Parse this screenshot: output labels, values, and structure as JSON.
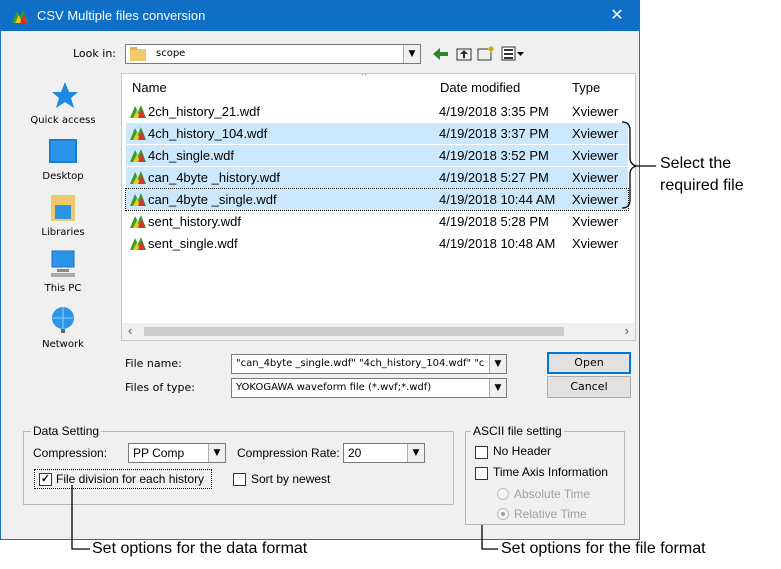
{
  "window": {
    "title": "CSV Multiple files conversion",
    "close_glyph": "✕"
  },
  "look_in": {
    "label": "Look in:",
    "value": "scope"
  },
  "places": [
    {
      "label": "Quick access",
      "icon": "star-icon"
    },
    {
      "label": "Desktop",
      "icon": "desktop-icon"
    },
    {
      "label": "Libraries",
      "icon": "libraries-icon"
    },
    {
      "label": "This PC",
      "icon": "computer-icon"
    },
    {
      "label": "Network",
      "icon": "network-icon"
    }
  ],
  "columns": {
    "name": "Name",
    "date": "Date modified",
    "type": "Type"
  },
  "files": [
    {
      "name": "2ch_history_21.wdf",
      "date": "4/19/2018 3:35 PM",
      "type": "Xviewer",
      "selected": false
    },
    {
      "name": "4ch_history_104.wdf",
      "date": "4/19/2018 3:37 PM",
      "type": "Xviewer",
      "selected": true
    },
    {
      "name": "4ch_single.wdf",
      "date": "4/19/2018 3:52 PM",
      "type": "Xviewer",
      "selected": true
    },
    {
      "name": "can_4byte _history.wdf",
      "date": "4/19/2018 5:27 PM",
      "type": "Xviewer",
      "selected": true
    },
    {
      "name": "can_4byte _single.wdf",
      "date": "4/19/2018 10:44 AM",
      "type": "Xviewer",
      "selected": true
    },
    {
      "name": "sent_history.wdf",
      "date": "4/19/2018 5:28 PM",
      "type": "Xviewer",
      "selected": false
    },
    {
      "name": "sent_single.wdf",
      "date": "4/19/2018 10:48 AM",
      "type": "Xviewer",
      "selected": false
    }
  ],
  "file_name": {
    "label": "File name:",
    "value": "\"can_4byte _single.wdf\" \"4ch_history_104.wdf\" \"c"
  },
  "file_type": {
    "label": "Files of type:",
    "value": "YOKOGAWA waveform file (*.wvf;*.wdf)"
  },
  "buttons": {
    "open": "Open",
    "cancel": "Cancel"
  },
  "data_setting": {
    "title": "Data Setting",
    "compression_label": "Compression:",
    "compression_value": "PP Comp",
    "rate_label": "Compression Rate:",
    "rate_value": "20",
    "file_division": {
      "label": "File division for each history",
      "checked": true
    },
    "sort_newest": {
      "label": "Sort by newest",
      "checked": false
    }
  },
  "ascii_setting": {
    "title": "ASCII file setting",
    "no_header": "No Header",
    "time_axis": "Time Axis Information",
    "absolute": "Absolute Time",
    "relative": "Relative Time"
  },
  "annotations": {
    "select_line1": "Select the",
    "select_line2": "required file",
    "data_format": "Set options for the data format",
    "file_format": "Set options for the file format"
  },
  "colors": {
    "titlebar": "#0f6fc6",
    "selection": "#cce8ff",
    "dialog_bg": "#f0f0f0"
  }
}
